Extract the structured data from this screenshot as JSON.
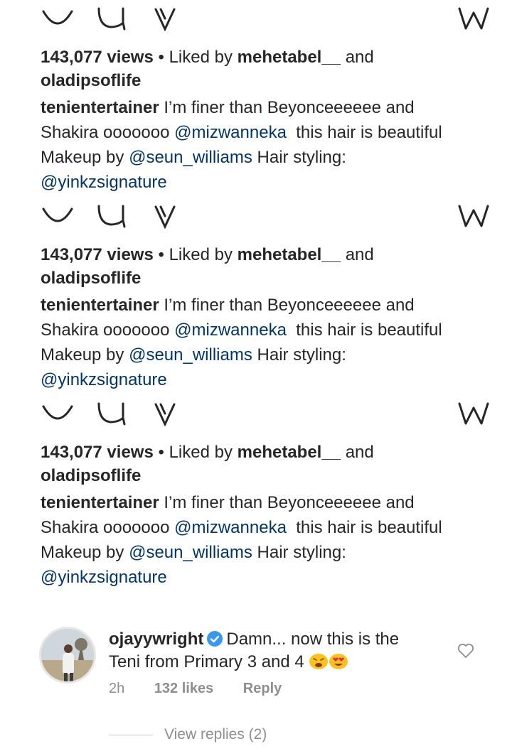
{
  "posts": [
    {
      "views": "143,077 views",
      "separator": "•",
      "liked_by_prefix": "Liked by",
      "liked_user_1": "mehetabel__",
      "liked_and": "and",
      "liked_user_2": "oladipsoflife",
      "caption_user": "tenientertainer",
      "caption_text_1": "I’m finer than Beyonceeeeee and",
      "caption_text_2a": "Shakira ooooooo",
      "mention_1": "@mizwanneka",
      "caption_text_2b": "this hair is beautiful",
      "caption_text_3a": "Makeup by",
      "mention_2": "@seun_williams",
      "caption_text_3b": "Hair styling:",
      "mention_3": "@yinkzsignature"
    },
    {
      "views": "143,077 views",
      "separator": "•",
      "liked_by_prefix": "Liked by",
      "liked_user_1": "mehetabel__",
      "liked_and": "and",
      "liked_user_2": "oladipsoflife",
      "caption_user": "tenientertainer",
      "caption_text_1": "I’m finer than Beyonceeeeee and",
      "caption_text_2a": "Shakira ooooooo",
      "mention_1": "@mizwanneka",
      "caption_text_2b": "this hair is beautiful",
      "caption_text_3a": "Makeup by",
      "mention_2": "@seun_williams",
      "caption_text_3b": "Hair styling:",
      "mention_3": "@yinkzsignature"
    },
    {
      "views": "143,077 views",
      "separator": "•",
      "liked_by_prefix": "Liked by",
      "liked_user_1": "mehetabel__",
      "liked_and": "and",
      "liked_user_2": "oladipsoflife",
      "caption_user": "tenientertainer",
      "caption_text_1": "I’m finer than Beyonceeeeee and",
      "caption_text_2a": "Shakira ooooooo",
      "mention_1": "@mizwanneka",
      "caption_text_2b": "this hair is beautiful",
      "caption_text_3a": "Makeup by",
      "mention_2": "@seun_williams",
      "caption_text_3b": "Hair styling:",
      "mention_3": "@yinkzsignature"
    }
  ],
  "comment": {
    "user": "ojayywright",
    "text_1": "Damn... now this is the",
    "text_2": "Teni from Primary 3 and 4",
    "emojis": [
      "weary-face-emoji",
      "heart-eyes-emoji"
    ],
    "time": "2h",
    "likes": "132 likes",
    "reply": "Reply",
    "view_replies": "View replies (2)"
  },
  "icons": {
    "like": "heart-outline-icon",
    "comment": "comment-bubble-icon",
    "share": "direct-share-icon",
    "save": "bookmark-icon",
    "comment_like": "small-heart-icon",
    "verified": "verified-badge-icon"
  },
  "colors": {
    "text": "#262626",
    "mention": "#003569",
    "muted": "#8e8e8e",
    "verified": "#3897f0"
  }
}
